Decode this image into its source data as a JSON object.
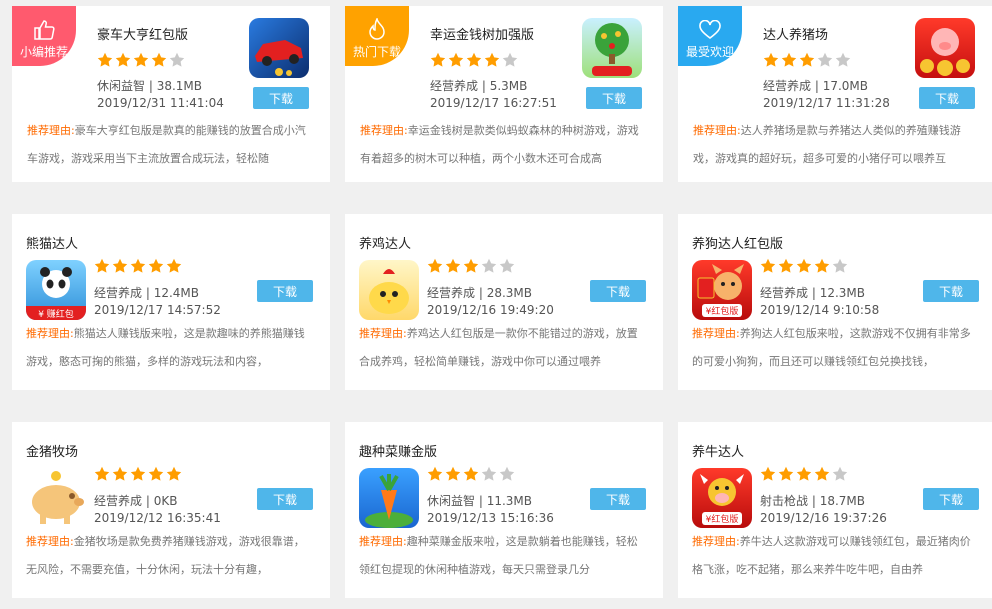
{
  "colors": {
    "accent": "#4fb6ea",
    "star": "#ff9d00",
    "reason_label": "#ff6a00"
  },
  "cards": [
    {
      "badge": "小编推荐",
      "badge_icon": "thumbs-up-icon",
      "badge_color": "#ff5a6e",
      "title": "豪车大亨红包版",
      "rating": 4,
      "category": "休闲益智",
      "size": "38.1MB",
      "date": "2019/12/31 11:41:04",
      "download": "下载",
      "reason_label": "推荐理由:",
      "reason": "豪车大亨红包版是款真的能赚钱的放置合成小汽车游戏，游戏采用当下主流放置合成玩法，轻松随",
      "app_icon": "race-car-icon"
    },
    {
      "badge": "热门下载",
      "badge_icon": "flame-icon",
      "badge_color": "#ffa200",
      "title": "幸运金钱树加强版",
      "rating": 4,
      "category": "经营养成",
      "size": "5.3MB",
      "date": "2019/12/17 16:27:51",
      "download": "下载",
      "reason_label": "推荐理由:",
      "reason": "幸运金钱树是款类似蚂蚁森林的种树游戏，游戏有着超多的树木可以种植，两个小数木还可合成高",
      "app_icon": "money-tree-icon"
    },
    {
      "badge": "最受欢迎",
      "badge_icon": "heart-icon",
      "badge_color": "#29a9f0",
      "title": "达人养猪场",
      "rating": 3,
      "category": "经营养成",
      "size": "17.0MB",
      "date": "2019/12/17 11:31:28",
      "download": "下载",
      "reason_label": "推荐理由:",
      "reason": "达人养猪场是款与养猪达人类似的养殖赚钱游戏，游戏真的超好玩，超多可爱的小猪仔可以喂养互",
      "app_icon": "pig-coins-icon"
    },
    {
      "title": "熊猫达人",
      "rating": 5,
      "category": "经营养成",
      "size": "12.4MB",
      "date": "2019/12/17 14:57:52",
      "download": "下载",
      "reason_label": "推荐理由:",
      "reason": "熊猫达人赚钱版来啦，这是款趣味的养熊猫赚钱游戏，憨态可掬的熊猫，多样的游戏玩法和内容，",
      "app_icon": "panda-icon",
      "icon_text": "¥ 赚红包"
    },
    {
      "title": "养鸡达人",
      "rating": 3,
      "category": "经营养成",
      "size": "28.3MB",
      "date": "2019/12/16 19:49:20",
      "download": "下载",
      "reason_label": "推荐理由:",
      "reason": "养鸡达人红包版是一款你不能错过的游戏，放置合成养鸡，轻松简单赚钱，游戏中你可以通过喂养",
      "app_icon": "chicken-icon"
    },
    {
      "title": "养狗达人红包版",
      "rating": 4,
      "category": "经营养成",
      "size": "12.3MB",
      "date": "2019/12/14 9:10:58",
      "download": "下载",
      "reason_label": "推荐理由:",
      "reason": "养狗达人红包版来啦，这款游戏不仅拥有非常多的可爱小狗狗，而且还可以赚钱领红包兑换找钱，",
      "app_icon": "dog-icon",
      "icon_text": "¥红包版"
    },
    {
      "title": "金猪牧场",
      "rating": 5,
      "category": "经营养成",
      "size": "0KB",
      "date": "2019/12/12 16:35:41",
      "download": "下载",
      "reason_label": "推荐理由:",
      "reason": "金猪牧场是款免费养猪赚钱游戏，游戏很靠谱，无风险，不需要充值，十分休闲，玩法十分有趣，",
      "app_icon": "golden-pig-icon"
    },
    {
      "title": "趣种菜赚金版",
      "rating": 3,
      "category": "休闲益智",
      "size": "11.3MB",
      "date": "2019/12/13 15:16:36",
      "download": "下载",
      "reason_label": "推荐理由:",
      "reason": "趣种菜赚金版来啦，这是款躺着也能赚钱，轻松领红包提现的休闲种植游戏，每天只需登录几分",
      "app_icon": "carrot-icon"
    },
    {
      "title": "养牛达人",
      "rating": 4,
      "category": "射击枪战",
      "size": "18.7MB",
      "date": "2019/12/16 19:37:26",
      "download": "下载",
      "reason_label": "推荐理由:",
      "reason": "养牛达人这款游戏可以赚钱领红包，最近猪肉价格飞涨，吃不起猪，那么来养牛吃牛吧，自由养",
      "app_icon": "cow-icon",
      "icon_text": "¥红包版"
    }
  ]
}
